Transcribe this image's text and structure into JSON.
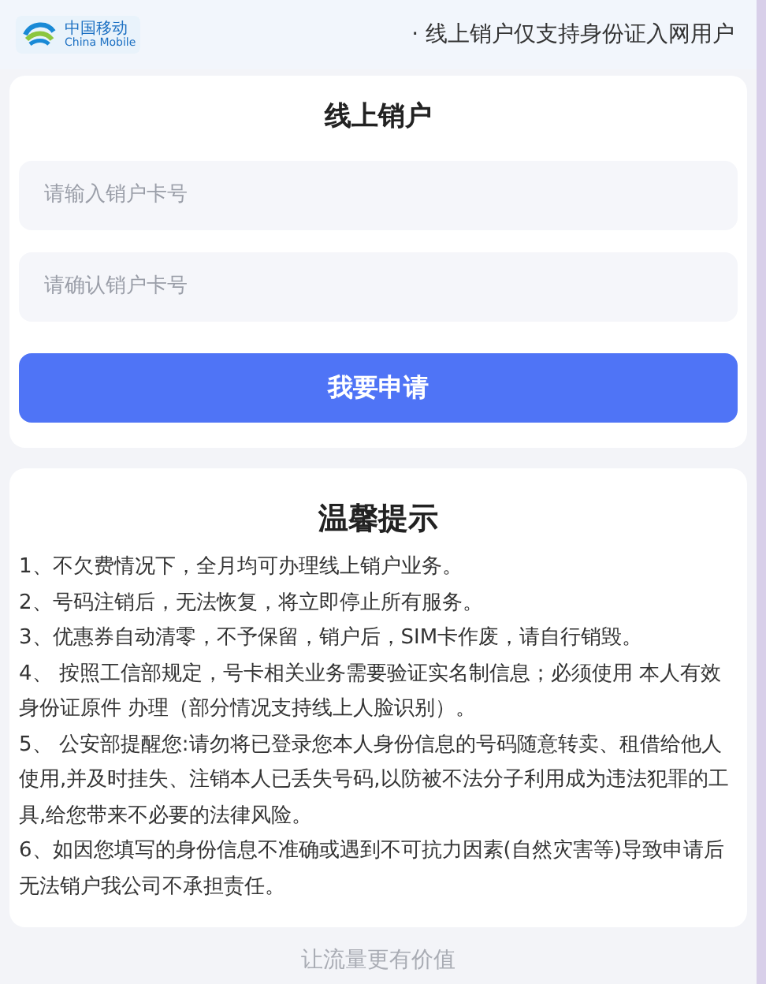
{
  "header": {
    "logo_cn": "中国移动",
    "logo_en": "China Mobile",
    "notice": "· 线上销户仅支持身份证入网用户"
  },
  "form": {
    "title": "线上销户",
    "fields": [
      {
        "placeholder": "请输入销户卡号"
      },
      {
        "placeholder": "请确认销户卡号"
      }
    ],
    "submit": "我要申请"
  },
  "tips": {
    "title": "温馨提示",
    "items": [
      "1、不欠费情况下，全月均可办理线上销户业务。",
      "2、号码注销后，无法恢复，将立即停止所有服务。",
      "3、优惠券自动清零，不予保留，销户后，SIM卡作废，请自行销毁。",
      "4、 按照工信部规定，号卡相关业务需要验证实名制信息；必须使用 本人有效身份证原件 办理（部分情况支持线上人脸识别）。",
      "5、 公安部提醒您:请勿将已登录您本人身份信息的号码随意转卖、租借给他人使用,并及时挂失、注销本人已丢失号码,以防被不法分子利用成为违法犯罪的工具,给您带来不必要的法律风险。",
      "6、如因您填写的身份信息不准确或遇到不可抗力因素(自然灾害等)导致申请后无法销户我公司不承担责任。"
    ]
  },
  "footer": {
    "slogan": "让流量更有价值"
  }
}
